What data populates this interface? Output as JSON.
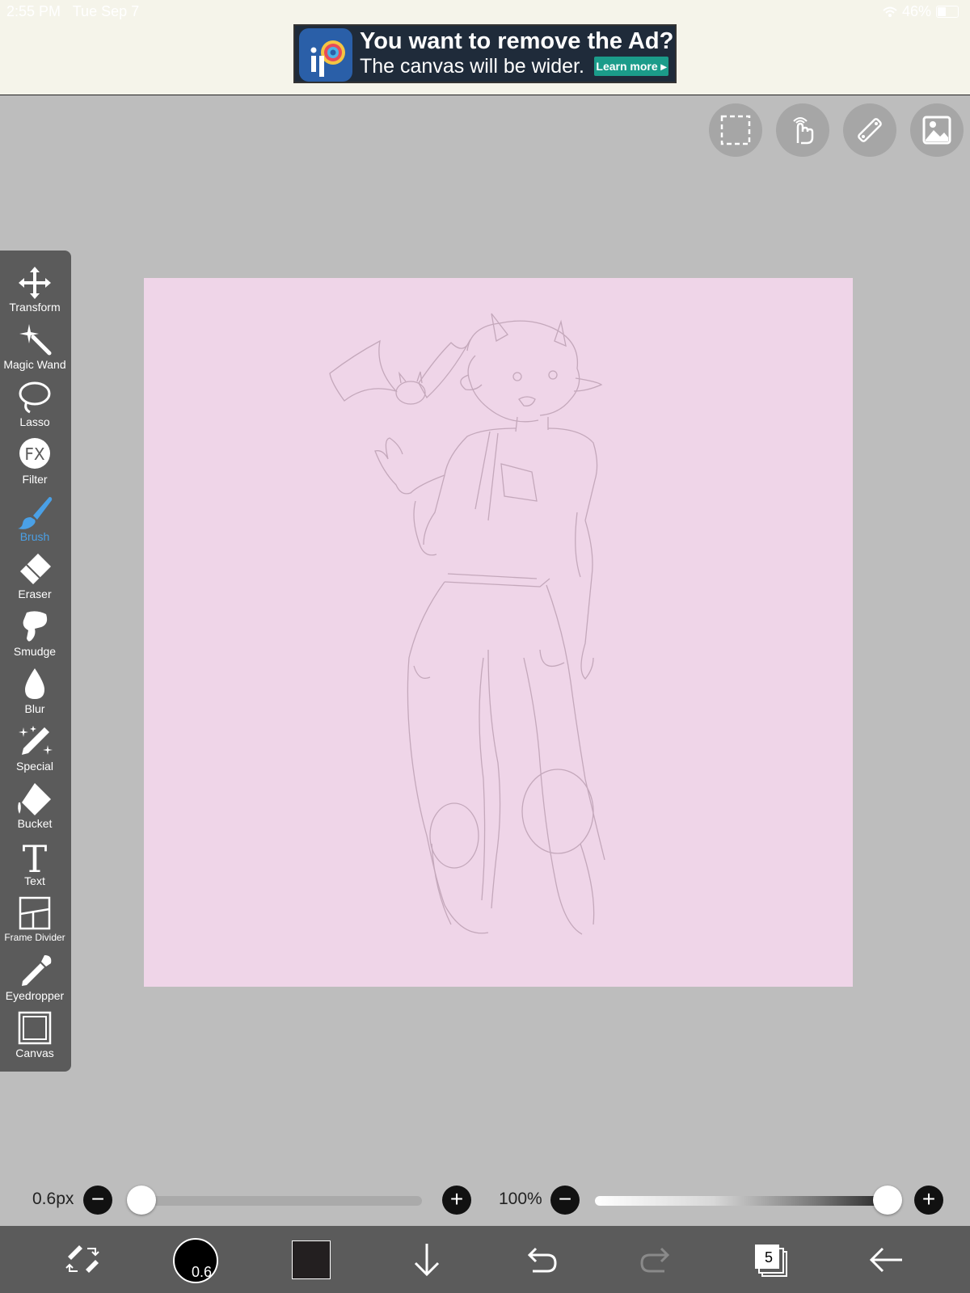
{
  "status": {
    "time": "2:55 PM",
    "date": "Tue Sep 7",
    "battery": "46%",
    "icons": [
      "wifi-icon",
      "battery-icon"
    ]
  },
  "ad": {
    "title": "You want to remove the Ad?",
    "subtitle": "The canvas will be wider.",
    "button": "Learn more"
  },
  "top_tools": [
    "selection-icon",
    "hand-gesture-icon",
    "ruler-icon",
    "image-icon"
  ],
  "sidebar": {
    "tools": [
      {
        "label": "Transform",
        "icon": "transform-icon"
      },
      {
        "label": "Magic Wand",
        "icon": "magic-wand-icon"
      },
      {
        "label": "Lasso",
        "icon": "lasso-icon"
      },
      {
        "label": "Filter",
        "icon": "fx-icon",
        "glyph": "FX"
      },
      {
        "label": "Brush",
        "icon": "brush-icon",
        "active": true
      },
      {
        "label": "Eraser",
        "icon": "eraser-icon"
      },
      {
        "label": "Smudge",
        "icon": "smudge-icon"
      },
      {
        "label": "Blur",
        "icon": "blur-drop-icon"
      },
      {
        "label": "Special",
        "icon": "special-pen-icon"
      },
      {
        "label": "Bucket",
        "icon": "bucket-icon"
      },
      {
        "label": "Text",
        "icon": "text-icon",
        "glyph": "T"
      },
      {
        "label": "Frame Divider",
        "icon": "frame-divider-icon"
      },
      {
        "label": "Eyedropper",
        "icon": "eyedropper-icon"
      },
      {
        "label": "Canvas",
        "icon": "canvas-icon"
      }
    ]
  },
  "canvas": {
    "background": "#efd5e8"
  },
  "brush": {
    "size_label": "0.6px",
    "size_fraction": 0.0,
    "opacity_label": "100%",
    "opacity_fraction": 1.0
  },
  "bottom_bar": {
    "brush_size_badge": "0.6",
    "color": "#231f20",
    "layers_count": "5"
  },
  "colors": {
    "toolbar": "#5b5b5b",
    "accent": "#4aa0e6",
    "workspace": "#bdbdbd"
  }
}
